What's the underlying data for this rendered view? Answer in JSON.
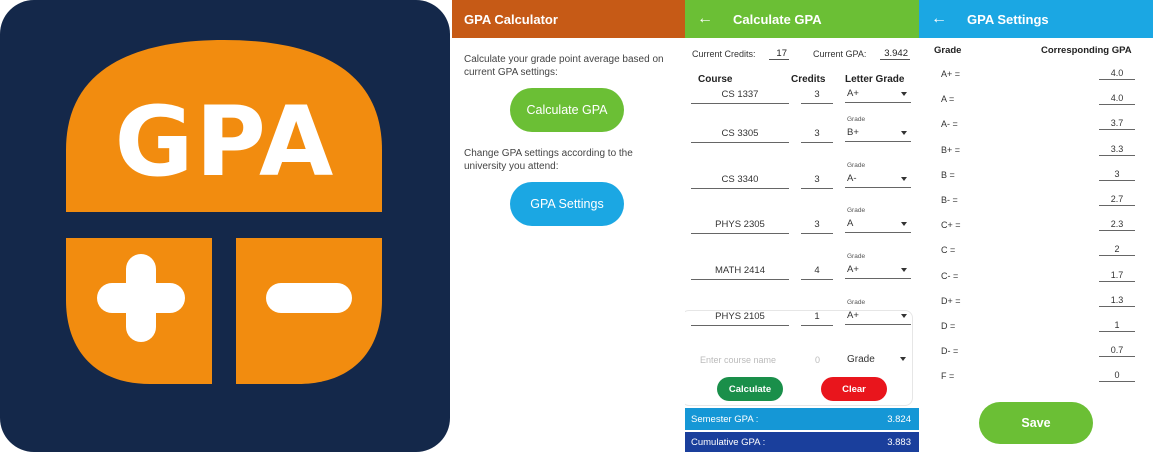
{
  "icon": {
    "text": "GPA",
    "bg_color": "#14284a",
    "accent_color": "#f28c0f",
    "plus_symbol": "plus-icon",
    "minus_symbol": "minus-icon"
  },
  "screen_home": {
    "title": "GPA Calculator",
    "bar_color": "#c65a16",
    "intro_text": "Calculate your grade point average based on current GPA settings:",
    "calc_button": "Calculate GPA",
    "settings_text": "Change GPA settings according to the university you attend:",
    "settings_button": "GPA Settings"
  },
  "screen_calc": {
    "title": "Calculate GPA",
    "bar_color": "#6bbf35",
    "current_credits_label": "Current Credits:",
    "current_credits": "17",
    "current_gpa_label": "Current GPA:",
    "current_gpa": "3.942",
    "col_course": "Course",
    "col_credits": "Credits",
    "col_grade": "Letter Grade",
    "grade_hint": "Grade",
    "rows": [
      {
        "course": "CS 1337",
        "credits": "3",
        "grade": "A+"
      },
      {
        "course": "CS 3305",
        "credits": "3",
        "grade": "B+"
      },
      {
        "course": "CS 3340",
        "credits": "3",
        "grade": "A-"
      },
      {
        "course": "PHYS 2305",
        "credits": "3",
        "grade": "A"
      },
      {
        "course": "MATH 2414",
        "credits": "4",
        "grade": "A+"
      },
      {
        "course": "PHYS 2105",
        "credits": "1",
        "grade": "A+"
      }
    ],
    "new_course_placeholder": "Enter course name",
    "new_credits_placeholder": "0",
    "new_grade_placeholder": "Grade",
    "calculate_button": "Calculate",
    "clear_button": "Clear",
    "semester_label": "Semester GPA :",
    "semester_value": "3.824",
    "cumulative_label": "Cumulative GPA :",
    "cumulative_value": "3.883"
  },
  "screen_settings": {
    "title": "GPA Settings",
    "bar_color": "#1ba7e3",
    "col_grade": "Grade",
    "col_value": "Corresponding GPA",
    "rows": [
      {
        "grade": "A+ =",
        "value": "4.0"
      },
      {
        "grade": "A =",
        "value": "4.0"
      },
      {
        "grade": "A- =",
        "value": "3.7"
      },
      {
        "grade": "B+ =",
        "value": "3.3"
      },
      {
        "grade": "B =",
        "value": "3"
      },
      {
        "grade": "B- =",
        "value": "2.7"
      },
      {
        "grade": "C+ =",
        "value": "2.3"
      },
      {
        "grade": "C =",
        "value": "2"
      },
      {
        "grade": "C- =",
        "value": "1.7"
      },
      {
        "grade": "D+ =",
        "value": "1.3"
      },
      {
        "grade": "D =",
        "value": "1"
      },
      {
        "grade": "D- =",
        "value": "0.7"
      },
      {
        "grade": "F =",
        "value": "0"
      }
    ],
    "save_button": "Save"
  }
}
